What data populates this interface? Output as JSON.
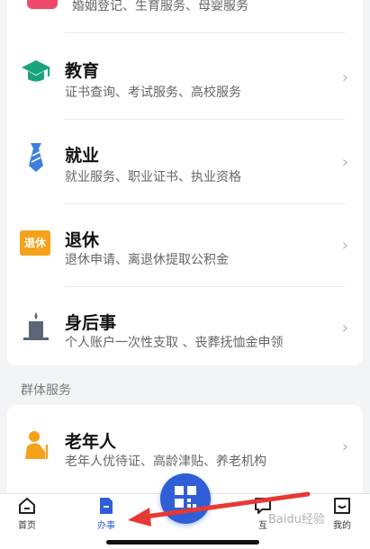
{
  "services": {
    "partial_item": {
      "desc": "婚姻登记、生育服务、母婴服务",
      "icon": "marriage-icon",
      "color": "#ef4a6b"
    },
    "items": [
      {
        "title": "教育",
        "desc": "证书查询、考试服务、高校服务",
        "icon": "graduation-cap-icon",
        "color": "#1aa37a"
      },
      {
        "title": "就业",
        "desc": "就业服务、职业证书、执业资格",
        "icon": "necktie-icon",
        "color": "#3d7fe0"
      },
      {
        "title": "退休",
        "desc": "退休申请、离退休提取公积金",
        "icon": "retirement-badge-icon",
        "icon_text": "退休",
        "color": "#f5a21b"
      },
      {
        "title": "身后事",
        "desc": "个人账户一次性支取 、丧葬抚恤金申领",
        "icon": "candle-icon",
        "color": "#5a6675"
      }
    ]
  },
  "group_section": {
    "label": "群体服务",
    "items": [
      {
        "title": "老年人",
        "desc": "老年人优待证、高龄津贴、养老机构",
        "icon": "elderly-person-icon",
        "color": "#f5a21b"
      }
    ]
  },
  "tabbar": {
    "items": [
      {
        "label": "首页",
        "icon": "home-icon",
        "active": false
      },
      {
        "label": "办事",
        "icon": "document-icon",
        "active": true
      },
      {
        "label": "互",
        "icon": "chat-icon",
        "active": false
      },
      {
        "label": "我的",
        "icon": "profile-icon",
        "active": false
      }
    ],
    "center_icon": "scan-qr-icon",
    "accent": "#2f5fd6"
  },
  "annotation": {
    "arrow_color": "#e53935"
  },
  "watermark": {
    "text": "Baidu经验"
  }
}
